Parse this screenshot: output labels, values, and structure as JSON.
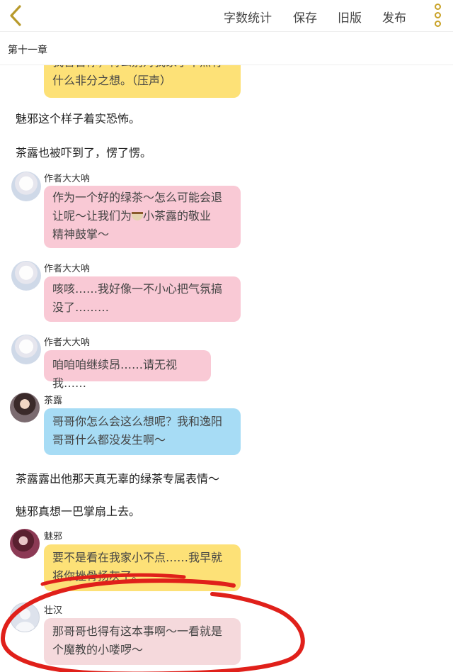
{
  "toolbar": {
    "stats_label": "字数统计",
    "save_label": "保存",
    "old_label": "旧版",
    "publish_label": "发布"
  },
  "chapter": {
    "title": "第十一章"
  },
  "messages": [
    {
      "speaker": "",
      "text_line1": "我警告你，特么别对我家小不点有",
      "text_line2": "什么非分之想。（压声）"
    },
    {
      "narration": "魅邪这个样子着实恐怖。"
    },
    {
      "narration": "茶露也被吓到了，愣了愣。"
    },
    {
      "speaker": "作者大大呐",
      "text_line1": "作为一个好的绿茶～怎么可能会退",
      "text_line2": "让呢～让我们为",
      "text_line2b": "小茶露的敬业",
      "text_line3": "精神鼓掌～"
    },
    {
      "speaker": "作者大大呐",
      "text_line1": "咳咳……我好像一不小心把气氛搞",
      "text_line2": "没了………"
    },
    {
      "speaker": "作者大大呐",
      "text_line1": "咱咱咱继续昂……请无视我……"
    },
    {
      "speaker": "茶露",
      "text_line1": "哥哥你怎么会这么想呢？我和逸阳",
      "text_line2": "哥哥什么都没发生啊～"
    },
    {
      "narration": "茶露露出他那天真无辜的绿茶专属表情～"
    },
    {
      "narration": "魅邪真想一巴掌扇上去。"
    },
    {
      "speaker": "魅邪",
      "text_line1": "要不是看在我家小不点……我早就",
      "text_line2": "将你挫骨扬灰了。"
    },
    {
      "speaker": "壮汉",
      "text_line1": "那哥哥也得有这本事啊～一看就是",
      "text_line2": "个魔教的小喽啰～"
    }
  ],
  "colors": {
    "bubble_yellow": "#fde177",
    "bubble_pink": "#f9c9d5",
    "bubble_blue": "#a7dcf5",
    "bubble_rose": "#f5d9dc",
    "annotation_red": "#e0201a",
    "toolbar_accent": "#c9a227"
  },
  "icons": [
    "chevron-left-icon",
    "more-vertical-icon",
    "tea-cup-emoji"
  ]
}
